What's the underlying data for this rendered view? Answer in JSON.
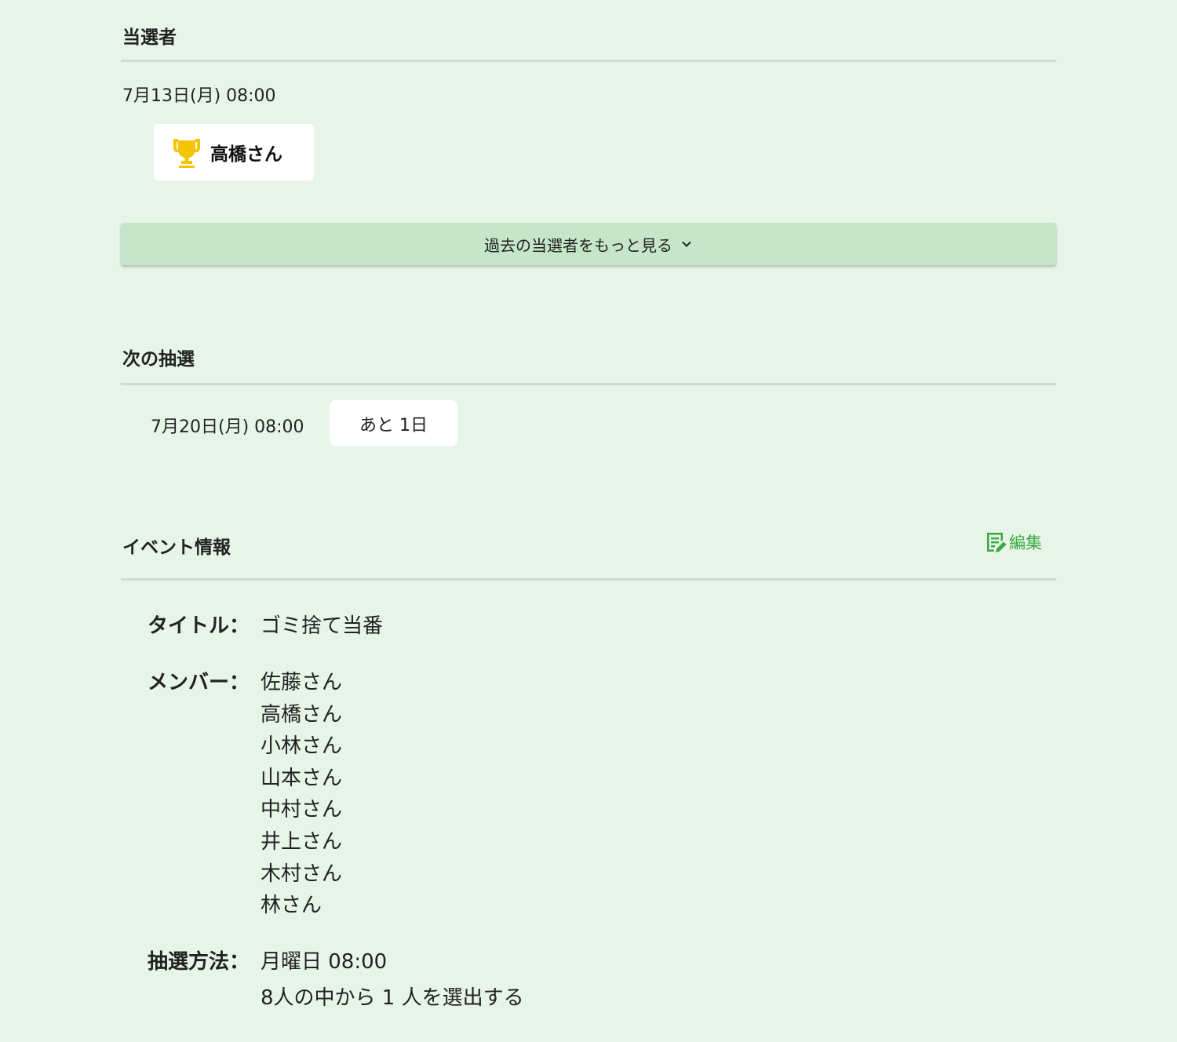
{
  "winners": {
    "heading": "当選者",
    "latest_date": "7月13日(月) 08:00",
    "latest_winner": "高橋さん",
    "more_button_label": "過去の当選者をもっと見る"
  },
  "next_draw": {
    "heading": "次の抽選",
    "date": "7月20日(月) 08:00",
    "remaining": "あと 1日"
  },
  "event_info": {
    "heading": "イベント情報",
    "edit_label": "編集",
    "title_label": "タイトル：",
    "title_value": "ゴミ捨て当番",
    "members_label": "メンバー：",
    "members": [
      "佐藤さん",
      "高橋さん",
      "小林さん",
      "山本さん",
      "中村さん",
      "井上さん",
      "木村さん",
      "林さん"
    ],
    "method_label": "抽選方法：",
    "method_schedule": "月曜日 08:00",
    "method_rule": "8人の中から 1 人を選出する"
  },
  "colors": {
    "background": "#e7f5e8",
    "more_button": "#c6e6ca",
    "accent_green": "#3aa944",
    "trophy_gold": "#f5c400"
  },
  "icons": {
    "trophy": "trophy-icon",
    "chevron": "chevron-down-icon",
    "edit": "edit-icon"
  }
}
